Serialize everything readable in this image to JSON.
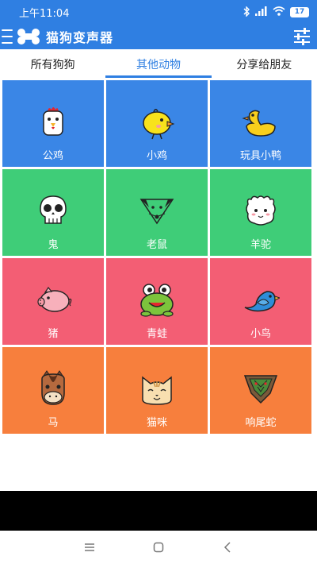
{
  "status_bar": {
    "time": "上午11:04",
    "battery_level": "17",
    "icons": [
      "bluetooth-icon",
      "signal-icon",
      "wifi-icon",
      "battery-icon"
    ]
  },
  "app_bar": {
    "title": "猫狗变声器",
    "icons": [
      "menu-icon",
      "bone-logo-icon",
      "settings-sliders-icon"
    ]
  },
  "tabs": [
    {
      "label": "所有狗狗"
    },
    {
      "label": "其他动物"
    },
    {
      "label": "分享给朋友"
    }
  ],
  "active_tab": 1,
  "animals": [
    {
      "label": "公鸡",
      "icon": "rooster-icon",
      "color": "#3a86e6"
    },
    {
      "label": "小鸡",
      "icon": "chick-icon",
      "color": "#3a86e6"
    },
    {
      "label": "玩具小鸭",
      "icon": "toy-duck-icon",
      "color": "#3a86e6"
    },
    {
      "label": "鬼",
      "icon": "skull-icon",
      "color": "#3fcd78"
    },
    {
      "label": "老鼠",
      "icon": "mouse-icon",
      "color": "#3fcd78"
    },
    {
      "label": "羊驼",
      "icon": "alpaca-icon",
      "color": "#3fcd78"
    },
    {
      "label": "猪",
      "icon": "pig-icon",
      "color": "#f35e74"
    },
    {
      "label": "青蛙",
      "icon": "frog-icon",
      "color": "#f35e74"
    },
    {
      "label": "小鸟",
      "icon": "bird-icon",
      "color": "#f35e74"
    },
    {
      "label": "马",
      "icon": "horse-icon",
      "color": "#f77f3d"
    },
    {
      "label": "猫咪",
      "icon": "cat-icon",
      "color": "#f77f3d"
    },
    {
      "label": "响尾蛇",
      "icon": "rattlesnake-icon",
      "color": "#f77f3d"
    }
  ],
  "nav_bar": {
    "icons": [
      "recents-icon",
      "home-icon",
      "back-icon"
    ]
  },
  "colors": {
    "primary": "#2f7fe2"
  }
}
